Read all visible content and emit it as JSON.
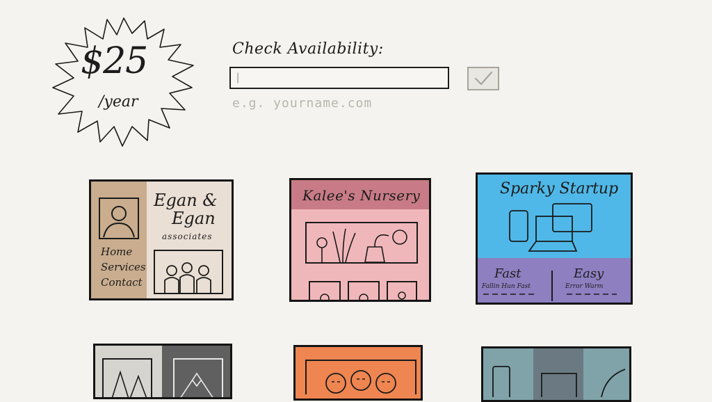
{
  "pricing": {
    "amount": "$25",
    "period": "/year"
  },
  "availability": {
    "label": "Check Availability:",
    "input_value": "",
    "input_placeholder": "|",
    "example_text": "e.g. yourname.com"
  },
  "themes": [
    {
      "title_line1": "Egan &",
      "title_line2": "Egan",
      "subtitle": "associates",
      "nav": [
        "Home",
        "Services",
        "Contact"
      ],
      "colors": {
        "sidebar": "#c9ad8e",
        "main": "#eadfd4"
      }
    },
    {
      "title": "Kalee's Nursery",
      "colors": {
        "header": "#c87b86",
        "body": "#f0b7ba"
      }
    },
    {
      "title": "Sparky Startup",
      "feature1_title": "Fast",
      "feature1_text": "Fallin Hun Fast",
      "feature2_title": "Easy",
      "feature2_text": "Error Warm",
      "colors": {
        "hero": "#4fb8e8",
        "features": "#8e7fc1"
      }
    },
    {
      "colors": {
        "left": "#d6d4ce",
        "right": "#606060"
      }
    },
    {
      "colors": {
        "main": "#ef8550"
      }
    },
    {
      "colors": {
        "main": "#7fa3a9",
        "center": "#6b7a82"
      }
    }
  ]
}
